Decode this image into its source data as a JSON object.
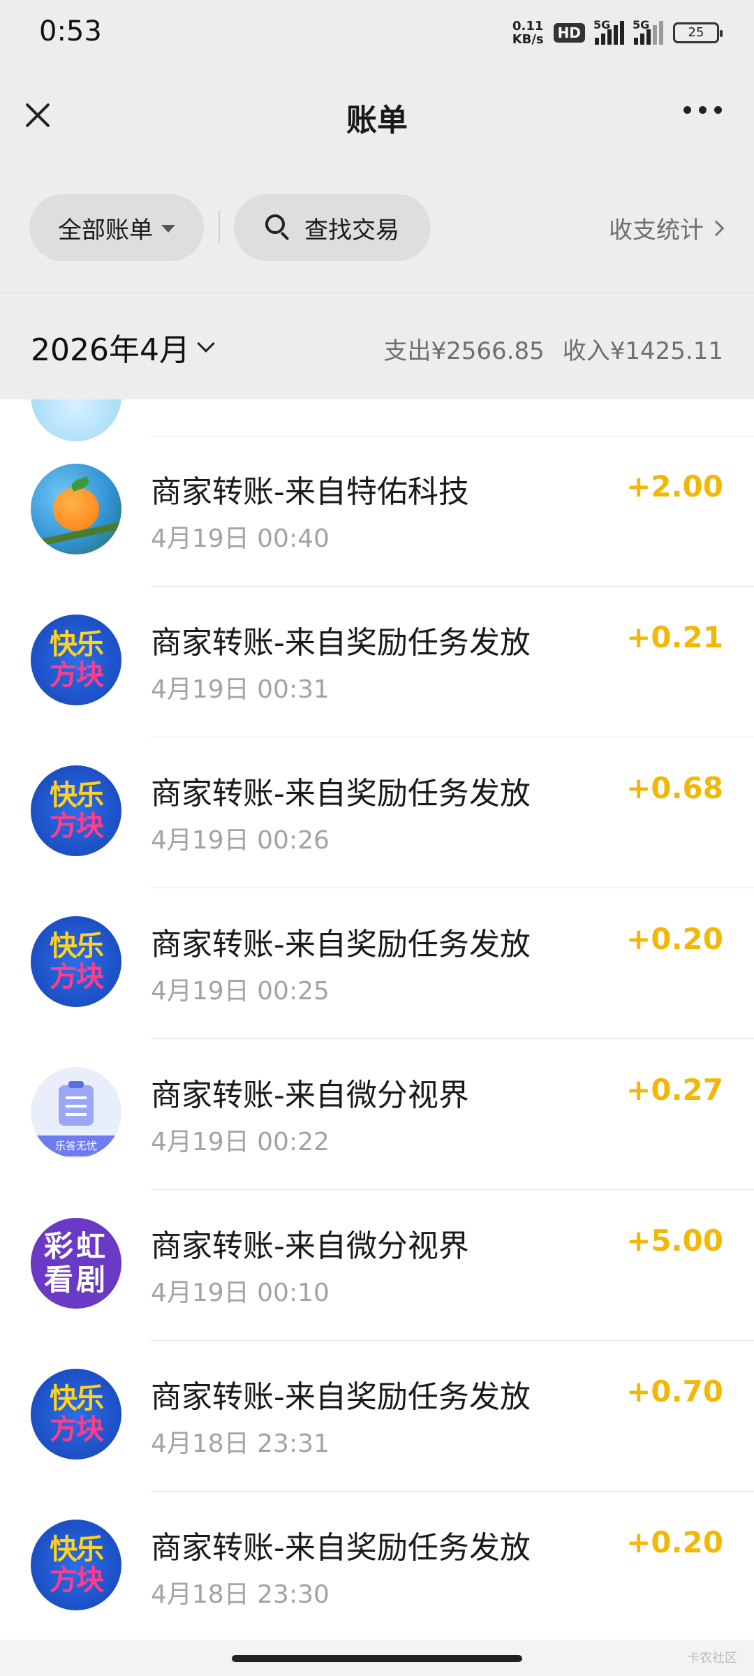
{
  "status_bar": {
    "time": "0:53",
    "net_speed_value": "0.11",
    "net_speed_unit": "KB/s",
    "hd": "HD",
    "sim1": "5G",
    "sim2": "5G",
    "battery": "25"
  },
  "nav": {
    "title": "账单"
  },
  "filters": {
    "all_bills": "全部账单",
    "search": "查找交易",
    "stats": "收支统计"
  },
  "month_bar": {
    "month": "2026年4月",
    "expense": "支出¥2566.85",
    "income": "收入¥1425.11"
  },
  "transactions": [
    {
      "title": "商家转账-来自特佑科技",
      "time": "4月19日 00:40",
      "amount": "+2.00",
      "icon": "orange-fruit-icon"
    },
    {
      "title": "商家转账-来自奖励任务发放",
      "time": "4月19日 00:31",
      "amount": "+0.21",
      "icon": "kuaile-fangkuai-icon"
    },
    {
      "title": "商家转账-来自奖励任务发放",
      "time": "4月19日 00:26",
      "amount": "+0.68",
      "icon": "kuaile-fangkuai-icon"
    },
    {
      "title": "商家转账-来自奖励任务发放",
      "time": "4月19日 00:25",
      "amount": "+0.20",
      "icon": "kuaile-fangkuai-icon"
    },
    {
      "title": "商家转账-来自微分视界",
      "time": "4月19日 00:22",
      "amount": "+0.27",
      "icon": "clipboard-icon"
    },
    {
      "title": "商家转账-来自微分视界",
      "time": "4月19日 00:10",
      "amount": "+5.00",
      "icon": "caihong-kanju-icon"
    },
    {
      "title": "商家转账-来自奖励任务发放",
      "time": "4月18日 23:31",
      "amount": "+0.70",
      "icon": "kuaile-fangkuai-icon"
    },
    {
      "title": "商家转账-来自奖励任务发放",
      "time": "4月18日 23:30",
      "amount": "+0.20",
      "icon": "kuaile-fangkuai-icon"
    }
  ],
  "avatar_text": {
    "kuaile_top": "快乐",
    "kuaile_bottom": "方块",
    "clip_ribbon": "乐答无忧",
    "caihong_top": "彩虹",
    "caihong_bottom": "看剧"
  },
  "watermark": "卡农社区",
  "colors": {
    "background": "#ededed",
    "amount": "#f2b807",
    "muted": "#a3a3a3"
  }
}
